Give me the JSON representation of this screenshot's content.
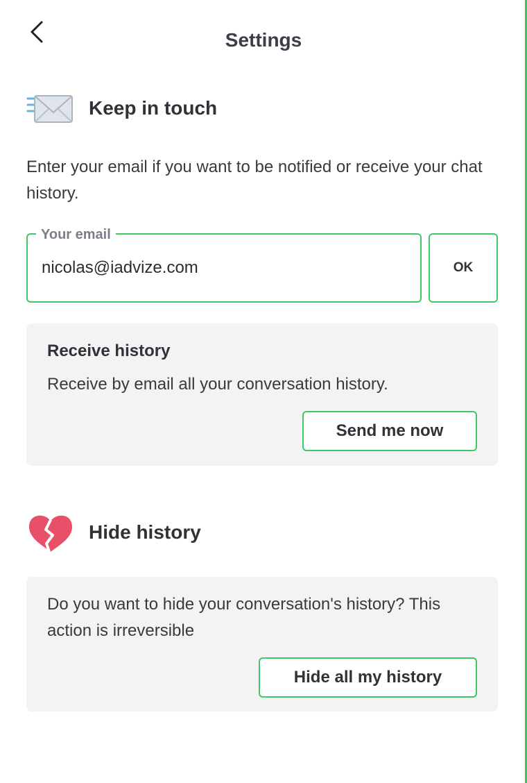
{
  "header": {
    "title": "Settings",
    "back_icon": "chevron-left-icon"
  },
  "keep_in_touch": {
    "title": "Keep in touch",
    "icon": "envelope-icon",
    "description": "Enter your email if you want to be notified or receive your chat history.",
    "email_label": "Your email",
    "email_value": "nicolas@iadvize.com",
    "ok_label": "OK"
  },
  "receive_history": {
    "title": "Receive history",
    "description": "Receive by email all your conversation history.",
    "button_label": "Send me now"
  },
  "hide_history": {
    "title": "Hide history",
    "icon": "broken-heart-icon",
    "description": "Do you want to hide your conversation's history? This action is irreversible",
    "button_label": "Hide all my history"
  },
  "colors": {
    "accent": "#3dc765",
    "card_bg": "#f3f3f3",
    "heart": "#e8506a"
  }
}
